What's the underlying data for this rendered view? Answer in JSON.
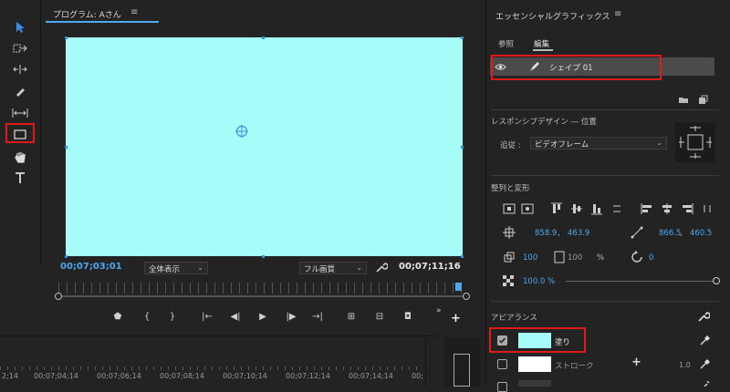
{
  "program": {
    "title": "プログラム: Aさん",
    "menu_icon": "≡",
    "timecode_current": "00;07;03;01",
    "timecode_end": "00;07;11;16",
    "zoom": "全体表示",
    "quality": "フル画質"
  },
  "timeline": {
    "ruler": [
      "2;14",
      "00;07;04;14",
      "00;07;06;14",
      "00;07;08;14",
      "00;07;10;14",
      "00;07;12;14",
      "00;07;14;14",
      "00;"
    ]
  },
  "essential": {
    "title": "エッセンシャルグラフィックス",
    "menu_icon": "≡",
    "tabs": [
      "参照",
      "編集"
    ],
    "layer_name": "シェイプ 01",
    "responsive_label": "レスポンシブデザイン ― 位置",
    "pin_label": "追従 :",
    "pin_value": "ビデオフレーム",
    "align_label": "整列と変形",
    "pos_x": "858.9",
    "pos_y": "463.9",
    "anchor_x": "866.5",
    "anchor_y": "460.5",
    "scale": "100",
    "scale_h": "100",
    "percent": "%",
    "rotation": "0",
    "opacity": "100.0 %",
    "appearance_label": "アピアランス",
    "fill_label": "塗り",
    "stroke_label": "ストローク",
    "stroke_width": "1.0",
    "fill_color": "#a6fcf8",
    "stroke_color": "#ffffff"
  },
  "colors": {
    "accent": "#4ea7f0",
    "highlight_red": "#e0191b",
    "video_bg": "#a6fcf8"
  }
}
